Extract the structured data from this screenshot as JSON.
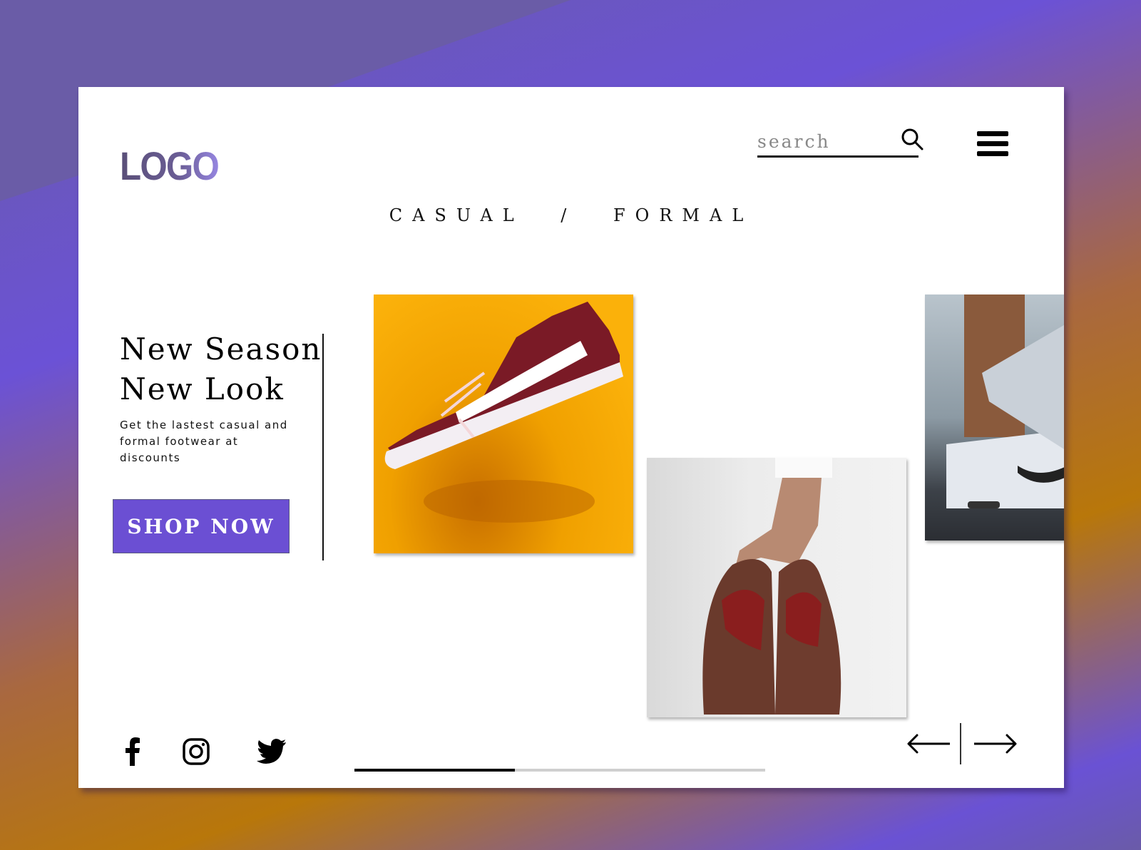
{
  "header": {
    "logo_text": "LOGO",
    "search": {
      "placeholder": "search",
      "value": ""
    },
    "search_icon": "search-icon",
    "menu_icon": "hamburger-menu-icon"
  },
  "categories": {
    "items": [
      "CASUAL",
      "FORMAL"
    ],
    "separator": "/"
  },
  "hero": {
    "title_line1": "New Season",
    "title_line2": "New Look",
    "subtitle": "Get the lastest casual and formal footwear at discounts",
    "cta_label": "SHOP NOW",
    "cta_color": "#6b4fd3"
  },
  "gallery": {
    "images": [
      {
        "alt": "Burgundy sneaker floating on yellow background"
      },
      {
        "alt": "Hand holding brown leather formal shoes"
      },
      {
        "alt": "White sneaker on asphalt with brown trousers"
      }
    ]
  },
  "footer": {
    "social": [
      {
        "name": "facebook",
        "icon": "facebook-icon"
      },
      {
        "name": "instagram",
        "icon": "instagram-icon"
      },
      {
        "name": "twitter",
        "icon": "twitter-icon"
      }
    ],
    "carousel_progress_percent": 39,
    "prev_icon": "arrow-left-icon",
    "next_icon": "arrow-right-icon"
  },
  "colors": {
    "accent": "#6b4fd3",
    "logo_gradient_start": "#5a4f78",
    "logo_gradient_end": "#9585e0",
    "progress_track": "#cfcfcf",
    "progress_fill": "#000000"
  }
}
